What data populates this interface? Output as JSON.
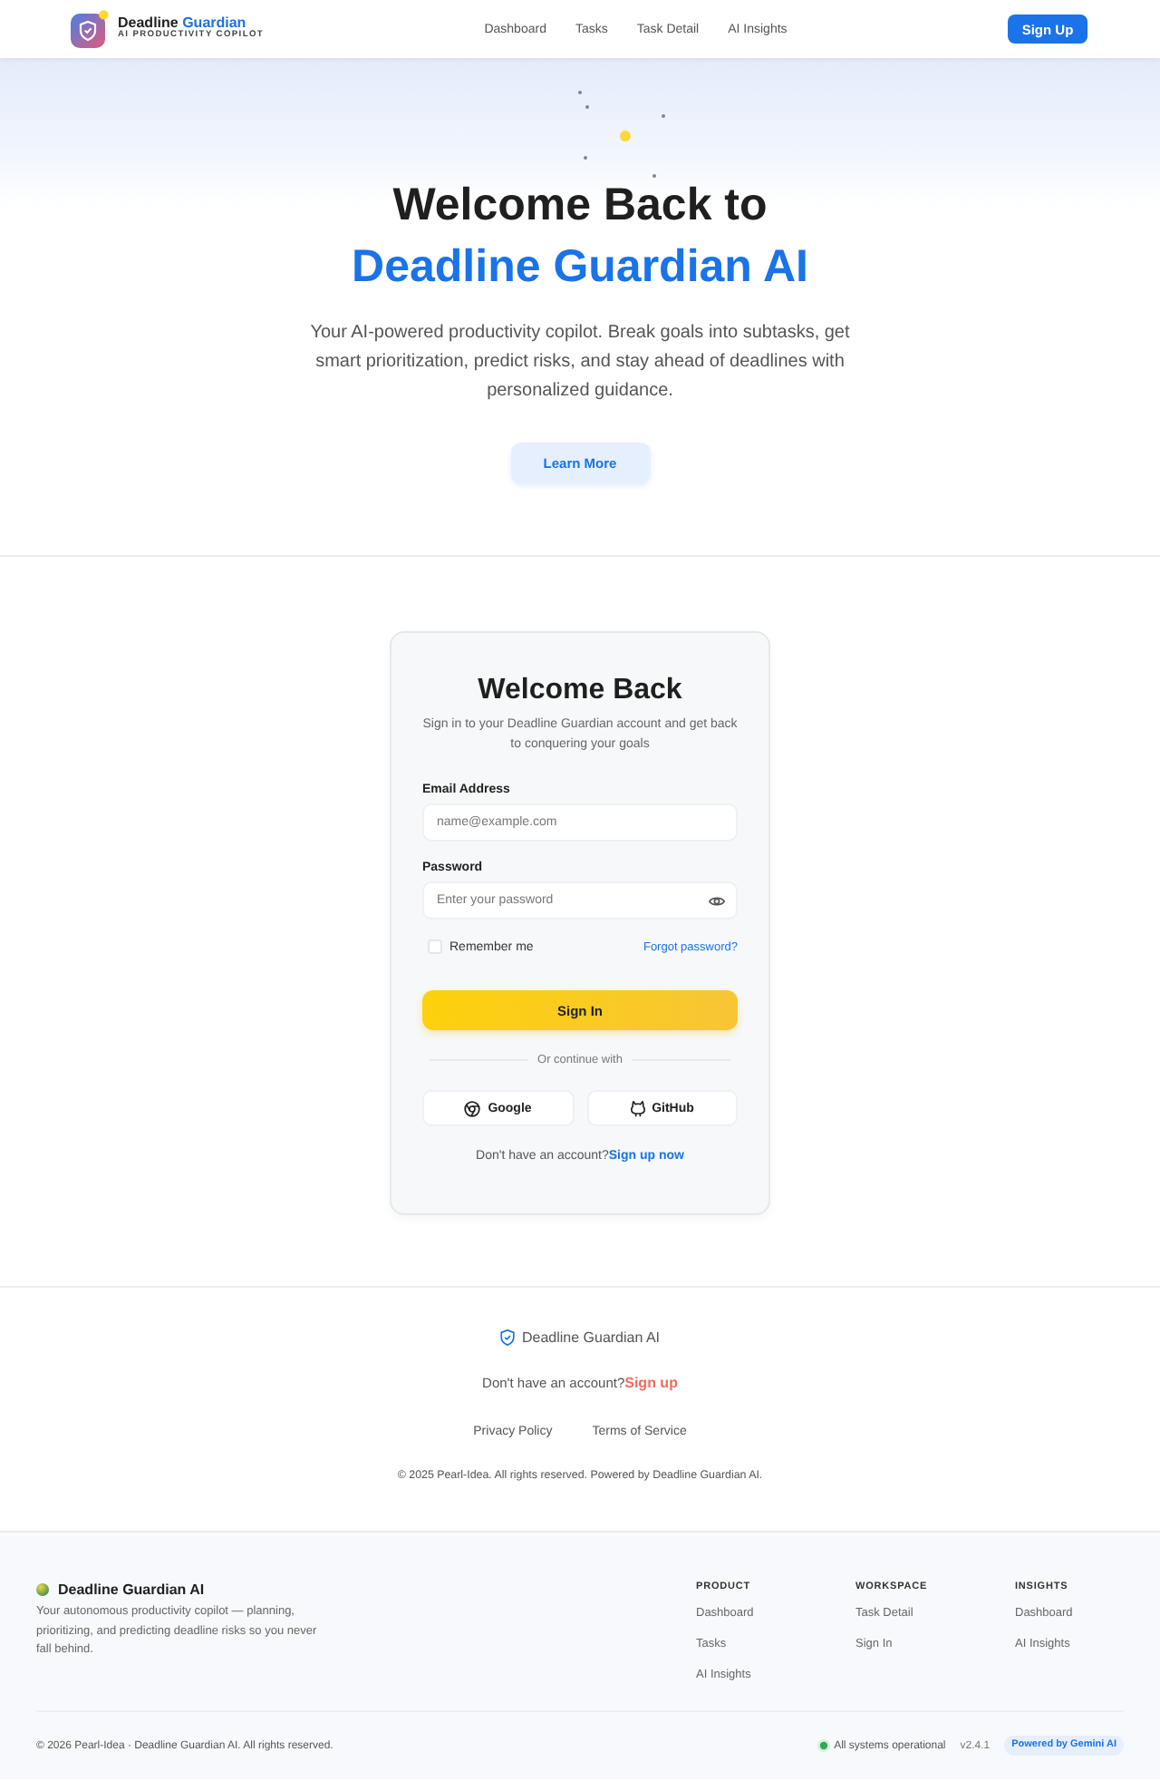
{
  "header": {
    "brand_name": "Deadline",
    "brand_highlight": "Guardian",
    "tagline": "AI PRODUCTIVITY COPILOT",
    "nav": [
      "Dashboard",
      "Tasks",
      "Task Detail",
      "AI Insights"
    ],
    "signup_button": "Sign Up"
  },
  "hero": {
    "title": "Welcome Back to",
    "title_highlight": "Deadline Guardian AI",
    "description": "Your AI-powered productivity copilot. Break goals into subtasks, get smart prioritization, predict risks, and stay ahead of deadlines with personalized guidance.",
    "button": "Learn More"
  },
  "login_card": {
    "title": "Welcome Back",
    "subtitle": "Sign in to your Deadline Guardian account and get back to conquering your goals",
    "fields": [
      {
        "kind": "email",
        "label": "Email Address",
        "placeholder": "name@example.com"
      },
      {
        "kind": "password",
        "label": "Password",
        "placeholder": "Enter your password"
      }
    ],
    "remember_me": {
      "label": "Remember me",
      "checked": false
    },
    "forgot_link": "Forgot password?",
    "submit_button": "Sign In",
    "divider_text": "Or continue with",
    "social_buttons": [
      {
        "kind": "google",
        "label": "Google"
      },
      {
        "kind": "github",
        "label": "GitHub"
      }
    ],
    "signup_prompt": "Don't have an account?",
    "signup_link": "Sign up now"
  },
  "footer_cta": {
    "brand": "Deadline Guardian AI",
    "signup_prompt": "Don't have an account?",
    "signup_link": "Sign up",
    "links": [
      "Privacy Policy",
      "Terms of Service"
    ],
    "copyright": "© 2025 Pearl-Idea. All rights reserved. Powered by Deadline Guardian AI."
  },
  "footer": {
    "brand": "Deadline Guardian AI",
    "description": "Your autonomous productivity copilot — planning, prioritizing, and predicting deadline risks so you never fall behind.",
    "columns": [
      {
        "heading": "PRODUCT",
        "links": [
          "Dashboard",
          "Tasks",
          "AI Insights"
        ]
      },
      {
        "heading": "WORKSPACE",
        "links": [
          "Task Detail",
          "Sign In"
        ]
      },
      {
        "heading": "INSIGHTS",
        "links": [
          "Dashboard",
          "AI Insights"
        ]
      }
    ],
    "copyright": "© 2026 Pearl-Idea · Deadline Guardian AI. All rights reserved.",
    "status": "All systems operational",
    "version": "v2.4.1",
    "badge": "Powered by Gemini AI"
  }
}
